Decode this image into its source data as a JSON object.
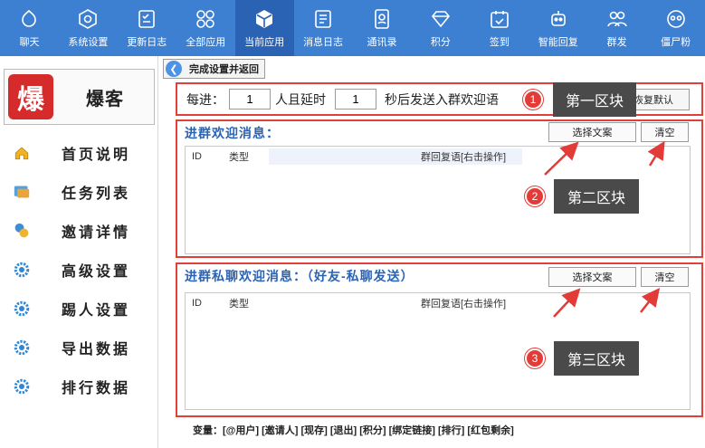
{
  "toolbar": {
    "items": [
      {
        "label": "聊天",
        "icon": "chat-icon"
      },
      {
        "label": "系统设置",
        "icon": "hexagon-settings-icon"
      },
      {
        "label": "更新日志",
        "icon": "checklist-icon"
      },
      {
        "label": "全部应用",
        "icon": "apps-icon"
      },
      {
        "label": "当前应用",
        "icon": "cube-icon"
      },
      {
        "label": "消息日志",
        "icon": "log-icon"
      },
      {
        "label": "通讯录",
        "icon": "contacts-icon"
      },
      {
        "label": "积分",
        "icon": "diamond-icon"
      },
      {
        "label": "签到",
        "icon": "calendar-check-icon"
      },
      {
        "label": "智能回复",
        "icon": "robot-icon"
      },
      {
        "label": "群发",
        "icon": "group-icon"
      },
      {
        "label": "僵尸粉",
        "icon": "zombie-icon"
      }
    ],
    "active_index": 4
  },
  "sidebar": {
    "brand_logo_char": "爆",
    "brand_name": "爆客",
    "items": [
      {
        "label": "首页说明",
        "icon": "home-icon"
      },
      {
        "label": "任务列表",
        "icon": "task-list-icon"
      },
      {
        "label": "邀请详情",
        "icon": "invite-icon"
      },
      {
        "label": "高级设置",
        "icon": "gear-icon"
      },
      {
        "label": "踢人设置",
        "icon": "gear-icon"
      },
      {
        "label": "导出数据",
        "icon": "gear-icon"
      },
      {
        "label": "排行数据",
        "icon": "gear-icon"
      }
    ]
  },
  "main": {
    "back_label": "完成设置并返回",
    "row1": {
      "prefix": "每进：",
      "count_value": "1",
      "middle": "人且延时",
      "delay_value": "1",
      "suffix": "秒后发送入群欢迎语",
      "reset_label": "恢复默认"
    },
    "section2": {
      "title": "进群欢迎消息：",
      "select_label": "选择文案",
      "clear_label": "清空",
      "col_id": "ID",
      "col_type": "类型",
      "col_reply": "群回复语[右击操作]"
    },
    "section3": {
      "title": "进群私聊欢迎消息：（好友-私聊发送）",
      "select_label": "选择文案",
      "clear_label": "清空",
      "col_id": "ID",
      "col_type": "类型",
      "col_reply": "群回复语[右击操作]"
    },
    "variables": "变量：[@用户] [邀请人] [现存] [退出] [积分] [绑定链接] [排行] [红包剩余]"
  },
  "annotations": [
    {
      "number": "1",
      "label": "第一区块"
    },
    {
      "number": "2",
      "label": "第二区块"
    },
    {
      "number": "3",
      "label": "第三区块"
    }
  ],
  "colors": {
    "toolbar_bg": "#3d7fd1",
    "toolbar_active": "#2a63b4",
    "section_border": "#e0403a",
    "title_blue": "#2a63b4",
    "annotation_bg": "#4a4a4a"
  }
}
